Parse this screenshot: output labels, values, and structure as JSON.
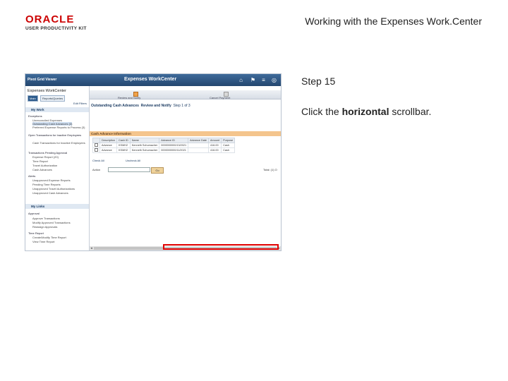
{
  "logo": {
    "line1": "ORACLE",
    "line2": "USER PRODUCTIVITY KIT"
  },
  "slide": {
    "title": "Working with the Expenses Work.Center",
    "step": "Step 15",
    "instruction_pre": "Click the ",
    "instruction_bold": "horizontal",
    "instruction_post": " scrollbar."
  },
  "app": {
    "topbar": {
      "pivot": "Pivot Grid Viewer",
      "title": "Expenses WorkCenter"
    },
    "left": {
      "title": "Expenses WorkCenter",
      "tabs": [
        "Main",
        "Reports/Queries"
      ],
      "edit_filters": "Edit Filters",
      "my_work": "My Work",
      "groups": [
        {
          "label": "Exceptions",
          "items": [
            "Unreconciled Expenses",
            "Outstanding Cash Advances (3)",
            "Preferred Expense Reports to Process (3)"
          ]
        },
        {
          "label": "Open Transactions for Inactive Employees",
          "items": [
            "Cash Transactions for Inactive Employees"
          ]
        },
        {
          "label": "Transactions Pending Approval",
          "items": [
            "Expense Report (20)",
            "Time Report",
            "Travel Authorization",
            "Cash Advances"
          ]
        },
        {
          "label": "Alerts",
          "items": [
            "Unapproved Expense Reports",
            "Pending Time Reports",
            "Unapproved Travel Authorizations",
            "Unapproved Cash Advances"
          ]
        }
      ],
      "links_header": "My Links",
      "links": [
        {
          "label": "Approval",
          "items": [
            "Approve Transactions",
            "Modify Approved Transactions",
            "Reassign Approvals"
          ]
        },
        {
          "label": "Time Report",
          "items": [
            "Create/Modify Time Report",
            "View Time Report"
          ]
        }
      ]
    },
    "main": {
      "train": [
        "Review and Notify",
        "Cancel Payment"
      ],
      "page_title": "Outstanding Cash Advances",
      "page_sub": "Review and Notify",
      "page_step": "Step 1 of 3",
      "grid_title": "Cash Advance Information",
      "columns": [
        "",
        "Description",
        "Cash ID",
        "Name",
        "Advance ID",
        "Advance Date",
        "Amount",
        "Purpose"
      ],
      "rows": [
        [
          "",
          "Advance",
          "KSMH2",
          "Kenneth Schumacher",
          "0000000000/13/2021",
          "",
          "416.00",
          "Cash"
        ],
        [
          "",
          "Advance",
          "KSMH2",
          "Kenneth Schumacher",
          "0000000000/11/2021",
          "",
          "416.00",
          "Cash"
        ]
      ],
      "check_all": "Check All",
      "uncheck_all": "Uncheck All",
      "action_label": "Action",
      "go_label": "Go",
      "total_label": "Total: (1) O"
    }
  },
  "colors": {
    "highlight": "#e00000",
    "topbar": "#2d5b8c"
  }
}
